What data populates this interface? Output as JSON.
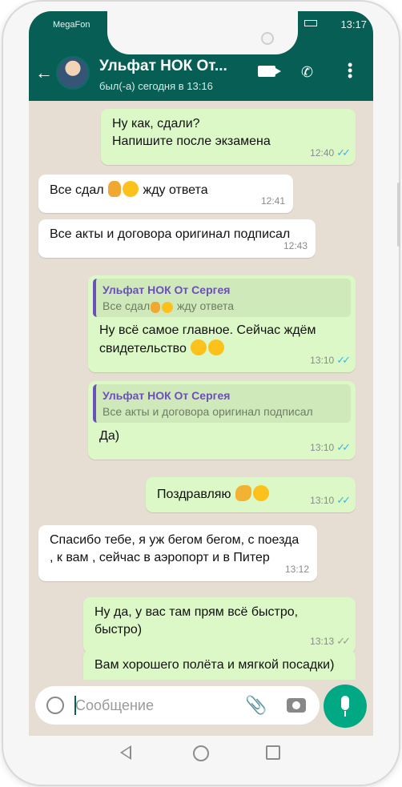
{
  "status": {
    "carrier": "MegaFon",
    "time": "13:17"
  },
  "header": {
    "title": "Ульфат НОК От...",
    "subtitle": "был(-а) сегодня в 13:16"
  },
  "messages": [
    {
      "dir": "out",
      "text": "Ну как, сдали?\nНапишите после экзамена",
      "time": "12:40",
      "ticks": "read"
    },
    {
      "dir": "in",
      "text": "Все сдал",
      "text_after": "жду ответа",
      "time": "12:41"
    },
    {
      "dir": "in",
      "text": "Все акты и договора оригинал подписал",
      "time": "12:43"
    },
    {
      "dir": "out",
      "quote_name": "Ульфат НОК От Сергея",
      "quote_text": "Все сдал",
      "quote_after": "жду ответа",
      "text": "Ну всё самое главное. Сейчас ждём свидетельство",
      "time": "13:10",
      "ticks": "read"
    },
    {
      "dir": "out",
      "quote_name": "Ульфат НОК От Сергея",
      "quote_text": "Все акты и договора оригинал подписал",
      "text": "Да)",
      "time": "13:10",
      "ticks": "read"
    },
    {
      "dir": "out",
      "text": "Поздравляю",
      "time": "13:10",
      "ticks": "read"
    },
    {
      "dir": "in",
      "text": "Спасибо тебе, я уж бегом бегом, с поезда , к вам , сейчас  в аэропорт и в Питер",
      "time": "13:12"
    },
    {
      "dir": "out",
      "text": "Ну да, у вас там прям всё быстро, быстро)",
      "time": "13:13",
      "ticks": "delivered"
    },
    {
      "dir": "out",
      "text": "Вам хорошего полёта и  мягкой посадки)"
    }
  ],
  "input": {
    "placeholder": "Сообщение"
  },
  "icons": {
    "back": "arrow-left-icon",
    "video": "video-call-icon",
    "call": "phone-icon",
    "menu": "more-vert-icon",
    "emoji": "emoji-icon",
    "attach": "paperclip-icon",
    "camera": "camera-icon",
    "mic": "mic-icon"
  },
  "colors": {
    "header": "#075e54",
    "outgoing": "#dcf8c6",
    "incoming": "#ffffff",
    "wallpaper": "#e6ddd3",
    "read_tick": "#34b7f1"
  }
}
